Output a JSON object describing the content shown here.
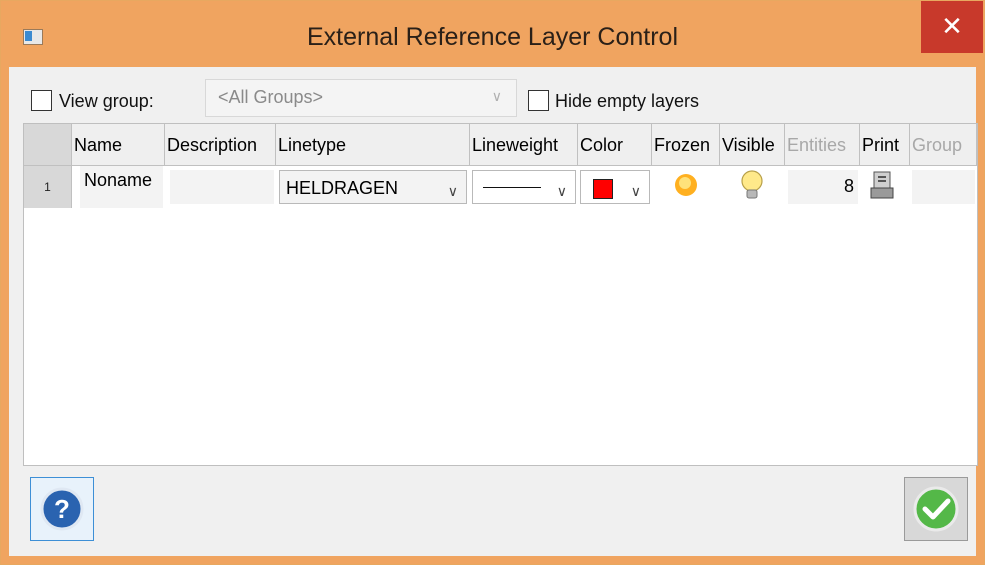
{
  "window": {
    "title": "External Reference Layer Control",
    "close_label": "✕"
  },
  "toolbar": {
    "view_group_label": "View group:",
    "group_combo_value": "<All Groups>",
    "hide_empty_label": "Hide empty layers"
  },
  "grid": {
    "columns": [
      "Name",
      "Description",
      "Linetype",
      "Lineweight",
      "Color",
      "Frozen",
      "Visible",
      "Entities",
      "Print",
      "Group"
    ],
    "rows": [
      {
        "index": "1",
        "name": "Noname",
        "description": "",
        "linetype": "HELDRAGEN",
        "entities": "8"
      }
    ]
  },
  "colors": {
    "layer_color": "#ff0000",
    "accent": "#f0a460",
    "close": "#c8392b"
  },
  "icons": {
    "frozen": "sun-icon",
    "visible": "lightbulb-icon",
    "print": "printer-icon",
    "help": "help-icon",
    "ok": "checkmark-icon"
  }
}
